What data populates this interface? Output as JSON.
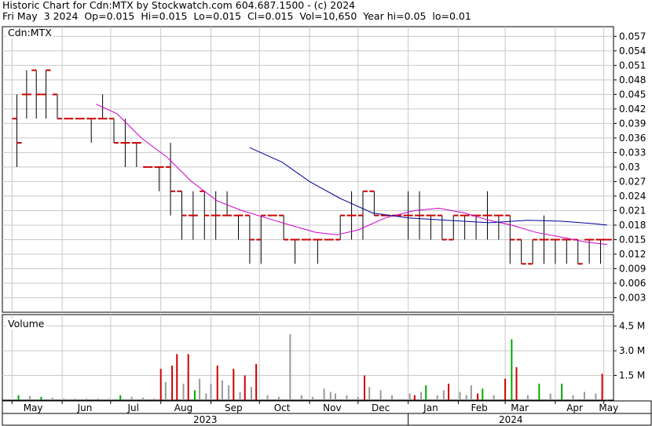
{
  "header": {
    "line1": "Historic Chart for Cdn:MTX by Stockwatch.com 604.687.1500 - (c) 2024",
    "line2": "Fri May  3 2024  Op=0.015  Hi=0.015  Lo=0.015  Cl=0.015  Vol=10,650  Year hi=0.05  lo=0.01"
  },
  "price_panel": {
    "label": "Cdn:MTX"
  },
  "volume_panel": {
    "label": "Volume"
  },
  "colors": {
    "bar": "#000000",
    "tick_red": "#cc0000",
    "ma_short": "#cc00cc",
    "ma_long": "#000099",
    "vol_up": "#00aa00",
    "vol_down": "#cc0000",
    "vol_flat": "#999999",
    "grid": "#c8c8c8"
  },
  "chart_data": [
    {
      "type": "line",
      "title": "Historic Chart for Cdn:MTX",
      "xlabel": "",
      "ylabel": "",
      "ylim": [
        0,
        0.059
      ],
      "y_ticks": [
        "0.057",
        "0.054",
        "0.051",
        "0.048",
        "0.045",
        "0.042",
        "0.039",
        "0.036",
        "0.033",
        "0.03",
        "0.027",
        "0.024",
        "0.021",
        "0.018",
        "0.015",
        "0.012",
        "0.009",
        "0.006",
        "0.003"
      ],
      "x_ticks": [
        "May",
        "Jun",
        "Jul",
        "Aug",
        "Sep",
        "Oct",
        "Nov",
        "Dec",
        "Jan",
        "Feb",
        "Mar",
        "Apr",
        "May"
      ],
      "year_labels": [
        "2023",
        "2024"
      ],
      "series": [
        {
          "style": "hlc-bars",
          "points": [
            [
              "2023-05-04",
              0.04,
              0.045,
              0.03,
              0.035
            ],
            [
              "2023-05-10",
              0.045,
              0.05,
              0.04,
              0.045
            ],
            [
              "2023-05-16",
              0.05,
              0.05,
              0.04,
              0.045
            ],
            [
              "2023-05-22",
              0.045,
              0.05,
              0.04,
              0.05
            ],
            [
              "2023-05-29",
              0.045,
              0.045,
              0.04,
              0.04
            ],
            [
              "2023-06-05",
              0.04,
              0.04,
              0.04,
              0.04
            ],
            [
              "2023-06-12",
              0.04,
              0.04,
              0.04,
              0.04
            ],
            [
              "2023-06-19",
              0.04,
              0.04,
              0.035,
              0.04
            ],
            [
              "2023-06-26",
              0.04,
              0.045,
              0.04,
              0.04
            ],
            [
              "2023-07-03",
              0.04,
              0.04,
              0.035,
              0.035
            ],
            [
              "2023-07-10",
              0.035,
              0.04,
              0.03,
              0.035
            ],
            [
              "2023-07-17",
              0.035,
              0.035,
              0.03,
              0.035
            ],
            [
              "2023-07-24",
              0.03,
              0.03,
              0.03,
              0.03
            ],
            [
              "2023-07-31",
              0.03,
              0.03,
              0.025,
              0.03
            ],
            [
              "2023-08-07",
              0.03,
              0.035,
              0.02,
              0.025
            ],
            [
              "2023-08-14",
              0.025,
              0.025,
              0.015,
              0.02
            ],
            [
              "2023-08-21",
              0.02,
              0.025,
              0.015,
              0.02
            ],
            [
              "2023-08-28",
              0.025,
              0.025,
              0.015,
              0.02
            ],
            [
              "2023-09-04",
              0.02,
              0.025,
              0.015,
              0.02
            ],
            [
              "2023-09-11",
              0.02,
              0.025,
              0.02,
              0.02
            ],
            [
              "2023-09-18",
              0.02,
              0.02,
              0.015,
              0.02
            ],
            [
              "2023-09-25",
              0.02,
              0.02,
              0.01,
              0.015
            ],
            [
              "2023-10-02",
              0.015,
              0.02,
              0.01,
              0.02
            ],
            [
              "2023-10-09",
              0.02,
              0.02,
              0.02,
              0.02
            ],
            [
              "2023-10-16",
              0.02,
              0.02,
              0.015,
              0.015
            ],
            [
              "2023-10-23",
              0.015,
              0.015,
              0.01,
              0.015
            ],
            [
              "2023-10-30",
              0.015,
              0.015,
              0.015,
              0.015
            ],
            [
              "2023-11-06",
              0.015,
              0.015,
              0.01,
              0.015
            ],
            [
              "2023-11-13",
              0.015,
              0.015,
              0.015,
              0.015
            ],
            [
              "2023-11-20",
              0.015,
              0.02,
              0.015,
              0.02
            ],
            [
              "2023-11-27",
              0.02,
              0.025,
              0.015,
              0.02
            ],
            [
              "2023-12-04",
              0.02,
              0.025,
              0.015,
              0.025
            ],
            [
              "2023-12-11",
              0.025,
              0.025,
              0.02,
              0.02
            ],
            [
              "2023-12-18",
              0.02,
              0.02,
              0.02,
              0.02
            ],
            [
              "2023-12-25",
              0.02,
              0.02,
              0.02,
              0.02
            ],
            [
              "2024-01-01",
              0.02,
              0.025,
              0.015,
              0.02
            ],
            [
              "2024-01-08",
              0.02,
              0.025,
              0.015,
              0.02
            ],
            [
              "2024-01-15",
              0.02,
              0.02,
              0.015,
              0.02
            ],
            [
              "2024-01-22",
              0.02,
              0.02,
              0.015,
              0.015
            ],
            [
              "2024-01-29",
              0.015,
              0.02,
              0.015,
              0.02
            ],
            [
              "2024-02-05",
              0.02,
              0.02,
              0.015,
              0.02
            ],
            [
              "2024-02-12",
              0.02,
              0.02,
              0.015,
              0.02
            ],
            [
              "2024-02-19",
              0.02,
              0.025,
              0.015,
              0.02
            ],
            [
              "2024-02-26",
              0.02,
              0.02,
              0.015,
              0.02
            ],
            [
              "2024-03-04",
              0.02,
              0.02,
              0.01,
              0.015
            ],
            [
              "2024-03-11",
              0.015,
              0.015,
              0.01,
              0.01
            ],
            [
              "2024-03-18",
              0.01,
              0.015,
              0.01,
              0.015
            ],
            [
              "2024-03-25",
              0.015,
              0.02,
              0.01,
              0.015
            ],
            [
              "2024-04-01",
              0.015,
              0.015,
              0.01,
              0.015
            ],
            [
              "2024-04-08",
              0.015,
              0.015,
              0.01,
              0.015
            ],
            [
              "2024-04-15",
              0.015,
              0.015,
              0.01,
              0.01
            ],
            [
              "2024-04-22",
              0.015,
              0.015,
              0.01,
              0.015
            ],
            [
              "2024-04-29",
              0.015,
              0.015,
              0.01,
              0.015
            ],
            [
              "2024-05-03",
              0.015,
              0.015,
              0.015,
              0.015
            ]
          ]
        },
        {
          "style": "ma-short",
          "x": [
            "2023-06-22",
            "2023-07-05",
            "2023-07-20",
            "2023-08-05",
            "2023-08-20",
            "2023-09-05",
            "2023-09-20",
            "2023-10-05",
            "2023-10-20",
            "2023-11-05",
            "2023-11-18",
            "2023-12-01",
            "2023-12-18",
            "2024-01-05",
            "2024-01-20",
            "2024-02-05",
            "2024-02-20",
            "2024-03-05",
            "2024-03-20",
            "2024-04-05",
            "2024-04-20",
            "2024-05-03"
          ],
          "y": [
            0.043,
            0.041,
            0.036,
            0.032,
            0.027,
            0.023,
            0.021,
            0.0195,
            0.018,
            0.0165,
            0.016,
            0.017,
            0.0195,
            0.021,
            0.0215,
            0.0205,
            0.019,
            0.018,
            0.0165,
            0.0155,
            0.0145,
            0.014
          ]
        },
        {
          "style": "ma-long",
          "x": [
            "2023-09-25",
            "2023-10-15",
            "2023-11-01",
            "2023-11-20",
            "2023-12-10",
            "2024-01-01",
            "2024-01-25",
            "2024-02-20",
            "2024-03-15",
            "2024-04-05",
            "2024-04-25",
            "2024-05-03"
          ],
          "y": [
            0.034,
            0.031,
            0.027,
            0.0235,
            0.0205,
            0.0195,
            0.019,
            0.0185,
            0.019,
            0.0188,
            0.0183,
            0.018
          ]
        }
      ]
    },
    {
      "type": "bar",
      "title": "Volume",
      "ylim": [
        0,
        5.2
      ],
      "y_ticks": [
        "4.5 M",
        "3.0 M",
        "1.5 M"
      ],
      "series": [
        {
          "x": [
            "2023-05-05",
            "2023-05-12",
            "2023-05-19",
            "2023-05-26",
            "2023-06-02",
            "2023-06-09",
            "2023-06-16",
            "2023-06-23",
            "2023-06-30",
            "2023-07-07",
            "2023-07-14",
            "2023-07-21",
            "2023-07-28",
            "2023-08-01",
            "2023-08-04",
            "2023-08-08",
            "2023-08-11",
            "2023-08-15",
            "2023-08-18",
            "2023-08-22",
            "2023-08-25",
            "2023-08-29",
            "2023-09-01",
            "2023-09-05",
            "2023-09-08",
            "2023-09-12",
            "2023-09-15",
            "2023-09-19",
            "2023-09-22",
            "2023-09-26",
            "2023-09-29",
            "2023-10-06",
            "2023-10-13",
            "2023-10-20",
            "2023-10-27",
            "2023-11-03",
            "2023-11-10",
            "2023-11-14",
            "2023-11-17",
            "2023-11-24",
            "2023-12-01",
            "2023-12-05",
            "2023-12-08",
            "2023-12-15",
            "2023-12-22",
            "2024-01-02",
            "2024-01-05",
            "2024-01-09",
            "2024-01-12",
            "2024-01-19",
            "2024-01-23",
            "2024-01-26",
            "2024-02-02",
            "2024-02-06",
            "2024-02-09",
            "2024-02-13",
            "2024-02-16",
            "2024-02-23",
            "2024-03-01",
            "2024-03-05",
            "2024-03-08",
            "2024-03-15",
            "2024-03-22",
            "2024-03-29",
            "2024-04-05",
            "2024-04-12",
            "2024-04-19",
            "2024-04-26",
            "2024-04-30",
            "2024-05-03"
          ],
          "y": [
            0.3,
            0.25,
            0.2,
            0.15,
            0.1,
            0.1,
            0.1,
            0.1,
            0.08,
            0.3,
            0.2,
            0.15,
            0.1,
            1.9,
            1.1,
            2.1,
            2.8,
            1.0,
            2.8,
            0.6,
            1.3,
            0.4,
            1.0,
            2.1,
            1.2,
            0.9,
            1.9,
            0.5,
            1.5,
            0.8,
            2.2,
            0.3,
            0.2,
            4.0,
            0.3,
            0.2,
            0.7,
            0.5,
            0.4,
            0.3,
            0.2,
            1.5,
            0.8,
            0.6,
            0.3,
            0.4,
            0.3,
            0.5,
            0.9,
            0.3,
            0.6,
            1.0,
            0.5,
            0.3,
            0.9,
            0.4,
            0.7,
            0.3,
            1.3,
            3.7,
            2.0,
            0.3,
            1.0,
            0.4,
            1.0,
            0.3,
            0.5,
            0.4,
            1.6,
            0.01
          ],
          "dir": [
            "u",
            "f",
            "u",
            "f",
            "f",
            "f",
            "f",
            "f",
            "f",
            "u",
            "f",
            "f",
            "f",
            "d",
            "f",
            "d",
            "d",
            "f",
            "d",
            "u",
            "f",
            "f",
            "f",
            "d",
            "f",
            "f",
            "d",
            "f",
            "d",
            "f",
            "d",
            "f",
            "f",
            "f",
            "f",
            "f",
            "f",
            "f",
            "f",
            "f",
            "f",
            "d",
            "f",
            "f",
            "f",
            "f",
            "d",
            "f",
            "u",
            "f",
            "f",
            "d",
            "f",
            "f",
            "f",
            "d",
            "u",
            "f",
            "d",
            "u",
            "d",
            "f",
            "u",
            "f",
            "u",
            "f",
            "f",
            "f",
            "d",
            "f"
          ]
        }
      ]
    }
  ]
}
